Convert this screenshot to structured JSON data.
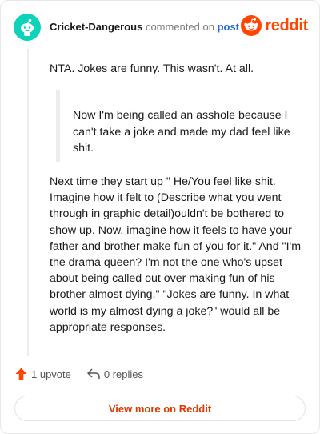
{
  "comment": {
    "author": "Cricket-Dangerous",
    "action_text": "commented on",
    "post_link_label": "post",
    "avatar_icon": "snoo-avatar-icon",
    "avatar_color": "#0dd3bb"
  },
  "brand": {
    "logo_icon": "reddit-alien-icon",
    "wordmark": "reddit",
    "color": "#ff4500"
  },
  "body": {
    "paragraph_1": "NTA. Jokes are funny. This wasn't. At all.",
    "quote": "Now I'm being called an asshole because I can't take a joke and made my dad feel like shit.",
    "paragraph_2": "Next time they start up \" He/You feel like shit. Imagine how it felt to (Describe what you went through in graphic detail)ouldn't be bothered to show up. Now, imagine how it feels to have your father and brother make fun of you for it.\" And \"I'm the drama queen? I'm not the one who's upset about being called out over making fun of his brother almost dying.\" \"Jokes are funny. In what world is my almost dying a joke?\" would all be appropriate responses."
  },
  "footer": {
    "upvote_icon": "upvote-arrow-icon",
    "upvote_label": "1 upvote",
    "reply_icon": "reply-arrow-icon",
    "replies_label": "0 replies",
    "view_button_label": "View more on Reddit"
  }
}
